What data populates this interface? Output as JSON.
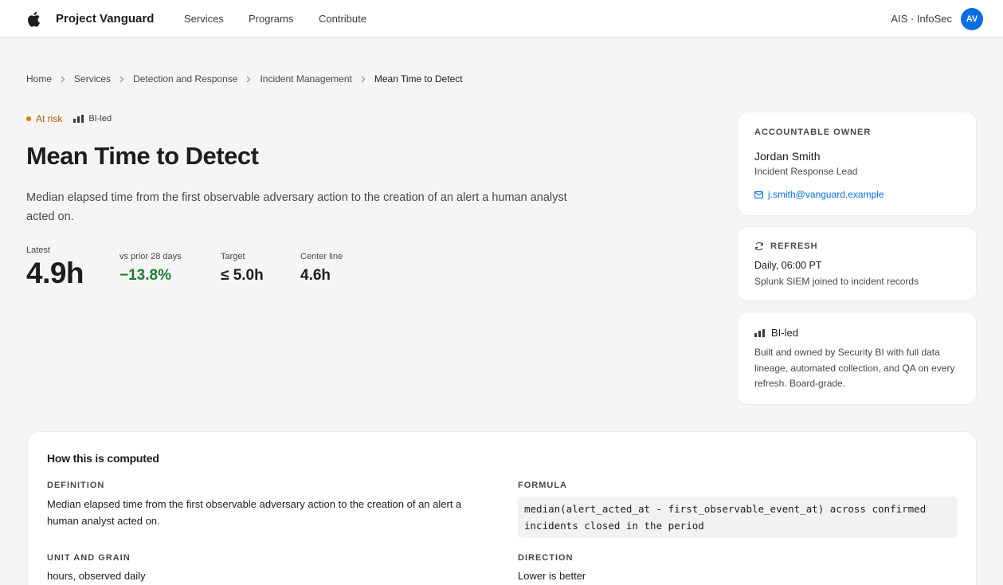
{
  "app": {
    "brand": "Project Vanguard",
    "nav": [
      "Services",
      "Programs",
      "Contribute"
    ],
    "org": "AIS · InfoSec",
    "avatar_initials": "AV"
  },
  "breadcrumb": [
    "Home",
    "Services",
    "Detection and Response",
    "Incident Management",
    "Mean Time to Detect"
  ],
  "header": {
    "status": "At risk",
    "status_color": "#e07a00",
    "badge": "BI-led",
    "title": "Mean Time to Detect",
    "description": "Median elapsed time from the first observable adversary action to the creation of an alert a human analyst acted on."
  },
  "metrics": {
    "latest_label": "Latest",
    "latest_value": "4.9h",
    "change_label": "vs prior 28 days",
    "change_value": "−13.8%",
    "change_color": "#1e7e34",
    "target_label": "Target",
    "target_value": "≤ 5.0h",
    "center_label": "Center line",
    "center_value": "4.6h"
  },
  "owner_card": {
    "eyebrow": "ACCOUNTABLE OWNER",
    "name": "Jordan Smith",
    "role": "Incident Response Lead",
    "email": "j.smith@vanguard.example"
  },
  "refresh_card": {
    "eyebrow": "REFRESH",
    "schedule": "Daily, 06:00 PT",
    "source": "Splunk SIEM joined to incident records"
  },
  "bi_card": {
    "title": "BI-led",
    "body": "Built and owned by Security BI with full data lineage, automated collection, and QA on every refresh. Board-grade."
  },
  "computation": {
    "title": "How this is computed",
    "definition_label": "DEFINITION",
    "definition": "Median elapsed time from the first observable adversary action to the creation of an alert a human analyst acted on.",
    "formula_label": "FORMULA",
    "formula": "median(alert_acted_at - first_observable_event_at) across confirmed incidents closed in the period",
    "unit_label": "UNIT AND GRAIN",
    "unit": "hours, observed daily",
    "direction_label": "DIRECTION",
    "direction": "Lower is better"
  }
}
